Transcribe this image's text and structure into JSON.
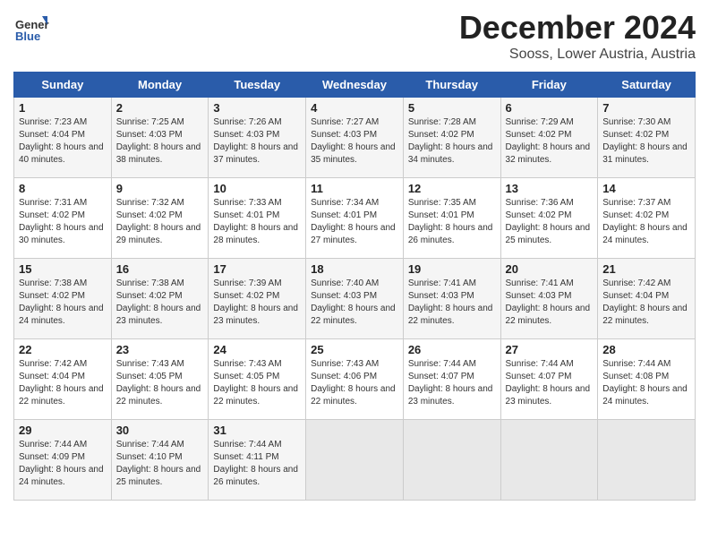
{
  "logo": {
    "text_general": "General",
    "text_blue": "Blue"
  },
  "header": {
    "title": "December 2024",
    "subtitle": "Sooss, Lower Austria, Austria"
  },
  "weekdays": [
    "Sunday",
    "Monday",
    "Tuesday",
    "Wednesday",
    "Thursday",
    "Friday",
    "Saturday"
  ],
  "weeks": [
    [
      {
        "day": "1",
        "sunrise": "7:23 AM",
        "sunset": "4:04 PM",
        "daylight": "8 hours and 40 minutes."
      },
      {
        "day": "2",
        "sunrise": "7:25 AM",
        "sunset": "4:03 PM",
        "daylight": "8 hours and 38 minutes."
      },
      {
        "day": "3",
        "sunrise": "7:26 AM",
        "sunset": "4:03 PM",
        "daylight": "8 hours and 37 minutes."
      },
      {
        "day": "4",
        "sunrise": "7:27 AM",
        "sunset": "4:03 PM",
        "daylight": "8 hours and 35 minutes."
      },
      {
        "day": "5",
        "sunrise": "7:28 AM",
        "sunset": "4:02 PM",
        "daylight": "8 hours and 34 minutes."
      },
      {
        "day": "6",
        "sunrise": "7:29 AM",
        "sunset": "4:02 PM",
        "daylight": "8 hours and 32 minutes."
      },
      {
        "day": "7",
        "sunrise": "7:30 AM",
        "sunset": "4:02 PM",
        "daylight": "8 hours and 31 minutes."
      }
    ],
    [
      {
        "day": "8",
        "sunrise": "7:31 AM",
        "sunset": "4:02 PM",
        "daylight": "8 hours and 30 minutes."
      },
      {
        "day": "9",
        "sunrise": "7:32 AM",
        "sunset": "4:02 PM",
        "daylight": "8 hours and 29 minutes."
      },
      {
        "day": "10",
        "sunrise": "7:33 AM",
        "sunset": "4:01 PM",
        "daylight": "8 hours and 28 minutes."
      },
      {
        "day": "11",
        "sunrise": "7:34 AM",
        "sunset": "4:01 PM",
        "daylight": "8 hours and 27 minutes."
      },
      {
        "day": "12",
        "sunrise": "7:35 AM",
        "sunset": "4:01 PM",
        "daylight": "8 hours and 26 minutes."
      },
      {
        "day": "13",
        "sunrise": "7:36 AM",
        "sunset": "4:02 PM",
        "daylight": "8 hours and 25 minutes."
      },
      {
        "day": "14",
        "sunrise": "7:37 AM",
        "sunset": "4:02 PM",
        "daylight": "8 hours and 24 minutes."
      }
    ],
    [
      {
        "day": "15",
        "sunrise": "7:38 AM",
        "sunset": "4:02 PM",
        "daylight": "8 hours and 24 minutes."
      },
      {
        "day": "16",
        "sunrise": "7:38 AM",
        "sunset": "4:02 PM",
        "daylight": "8 hours and 23 minutes."
      },
      {
        "day": "17",
        "sunrise": "7:39 AM",
        "sunset": "4:02 PM",
        "daylight": "8 hours and 23 minutes."
      },
      {
        "day": "18",
        "sunrise": "7:40 AM",
        "sunset": "4:03 PM",
        "daylight": "8 hours and 22 minutes."
      },
      {
        "day": "19",
        "sunrise": "7:41 AM",
        "sunset": "4:03 PM",
        "daylight": "8 hours and 22 minutes."
      },
      {
        "day": "20",
        "sunrise": "7:41 AM",
        "sunset": "4:03 PM",
        "daylight": "8 hours and 22 minutes."
      },
      {
        "day": "21",
        "sunrise": "7:42 AM",
        "sunset": "4:04 PM",
        "daylight": "8 hours and 22 minutes."
      }
    ],
    [
      {
        "day": "22",
        "sunrise": "7:42 AM",
        "sunset": "4:04 PM",
        "daylight": "8 hours and 22 minutes."
      },
      {
        "day": "23",
        "sunrise": "7:43 AM",
        "sunset": "4:05 PM",
        "daylight": "8 hours and 22 minutes."
      },
      {
        "day": "24",
        "sunrise": "7:43 AM",
        "sunset": "4:05 PM",
        "daylight": "8 hours and 22 minutes."
      },
      {
        "day": "25",
        "sunrise": "7:43 AM",
        "sunset": "4:06 PM",
        "daylight": "8 hours and 22 minutes."
      },
      {
        "day": "26",
        "sunrise": "7:44 AM",
        "sunset": "4:07 PM",
        "daylight": "8 hours and 23 minutes."
      },
      {
        "day": "27",
        "sunrise": "7:44 AM",
        "sunset": "4:07 PM",
        "daylight": "8 hours and 23 minutes."
      },
      {
        "day": "28",
        "sunrise": "7:44 AM",
        "sunset": "4:08 PM",
        "daylight": "8 hours and 24 minutes."
      }
    ],
    [
      {
        "day": "29",
        "sunrise": "7:44 AM",
        "sunset": "4:09 PM",
        "daylight": "8 hours and 24 minutes."
      },
      {
        "day": "30",
        "sunrise": "7:44 AM",
        "sunset": "4:10 PM",
        "daylight": "8 hours and 25 minutes."
      },
      {
        "day": "31",
        "sunrise": "7:44 AM",
        "sunset": "4:11 PM",
        "daylight": "8 hours and 26 minutes."
      },
      null,
      null,
      null,
      null
    ]
  ],
  "labels": {
    "sunrise": "Sunrise:",
    "sunset": "Sunset:",
    "daylight": "Daylight:"
  }
}
